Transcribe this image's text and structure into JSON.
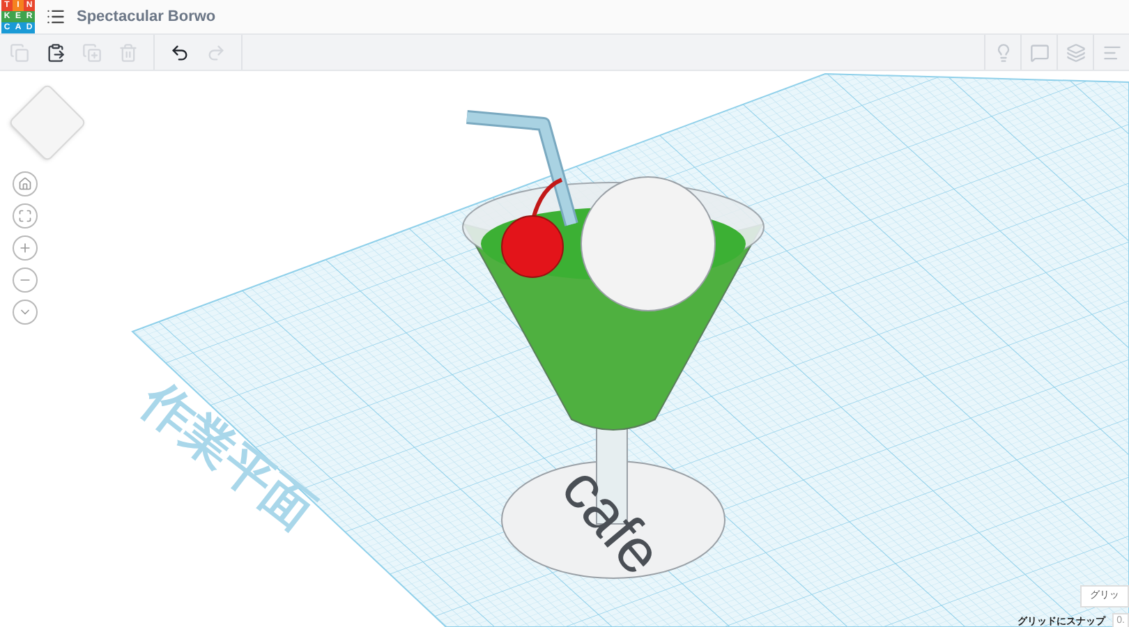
{
  "header": {
    "logo_letters": [
      "T",
      "I",
      "N",
      "K",
      "E",
      "R",
      "C",
      "A",
      "D"
    ],
    "design_title": "Spectacular Borwo"
  },
  "toolbar": {
    "left_tools": [
      {
        "kind": "copy",
        "disabled": true
      },
      {
        "kind": "paste",
        "disabled": false
      },
      {
        "kind": "duplicate",
        "disabled": true
      },
      {
        "kind": "delete",
        "disabled": true
      },
      {
        "kind": "undo",
        "disabled": false
      },
      {
        "kind": "redo",
        "disabled": true
      }
    ],
    "right_tools": [
      {
        "kind": "note"
      },
      {
        "kind": "shape"
      },
      {
        "kind": "group"
      },
      {
        "kind": "list"
      }
    ]
  },
  "view_controls": [
    {
      "kind": "home"
    },
    {
      "kind": "fit"
    },
    {
      "kind": "zoom_in"
    },
    {
      "kind": "zoom_out"
    },
    {
      "kind": "perspective"
    }
  ],
  "workplane": {
    "label": "作業平面",
    "coaster_text": "cafe"
  },
  "grid_settings": {
    "edit_grid_label": "グリッ",
    "snap_label": "グリッドにスナップ",
    "snap_value": "0."
  }
}
